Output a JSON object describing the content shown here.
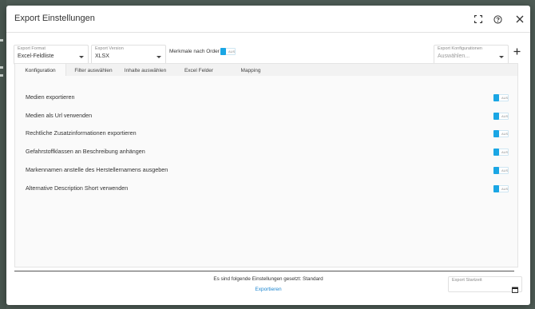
{
  "dialog": {
    "title": "Export Einstellungen",
    "header_icons": [
      "fullscreen-icon",
      "help-icon",
      "close-icon"
    ]
  },
  "toolbar": {
    "export_format": {
      "label": "Export Format",
      "value": "Excel-Feldliste"
    },
    "export_version": {
      "label": "Export Version",
      "value": "XLSX"
    },
    "features_by_order": {
      "label": "Merkmale nach Order",
      "toggle_text": "AUS"
    },
    "export_configurations": {
      "label": "Export Konfigurationen",
      "placeholder": "Auswählen..."
    },
    "add_icon": "plus-icon"
  },
  "tabs": [
    {
      "label": "Konfiguration",
      "active": true
    },
    {
      "label": "Filter auswählen",
      "active": false
    },
    {
      "label": "Inhalte auswählen",
      "active": false
    },
    {
      "label": "Excel Felder",
      "active": false
    },
    {
      "label": "Mapping",
      "active": false
    }
  ],
  "settings": [
    {
      "label": "Medien exportieren",
      "toggle_text": "AUS"
    },
    {
      "label": "Medien als Url verwenden",
      "toggle_text": "AUS"
    },
    {
      "label": "Rechtliche Zusatzinformationen exportieren",
      "toggle_text": "AUS"
    },
    {
      "label": "Gefahrstoffklassen an Beschreibung anhängen",
      "toggle_text": "AUS"
    },
    {
      "label": "Markennamen anstelle des Herstellernamens ausgeben",
      "toggle_text": "AUS"
    },
    {
      "label": "Alternative Description Short verwenden",
      "toggle_text": "AUS"
    }
  ],
  "footer": {
    "status": "Es sind folgende Einstellungen gesetzt: Standard",
    "export_link": "Exportieren",
    "start_date_label": "Export Startzeit",
    "calendar_icon": "calendar-icon"
  },
  "colors": {
    "accent": "#1aa6e4",
    "link": "#1d86d0",
    "backdrop": "#4e5c55"
  }
}
